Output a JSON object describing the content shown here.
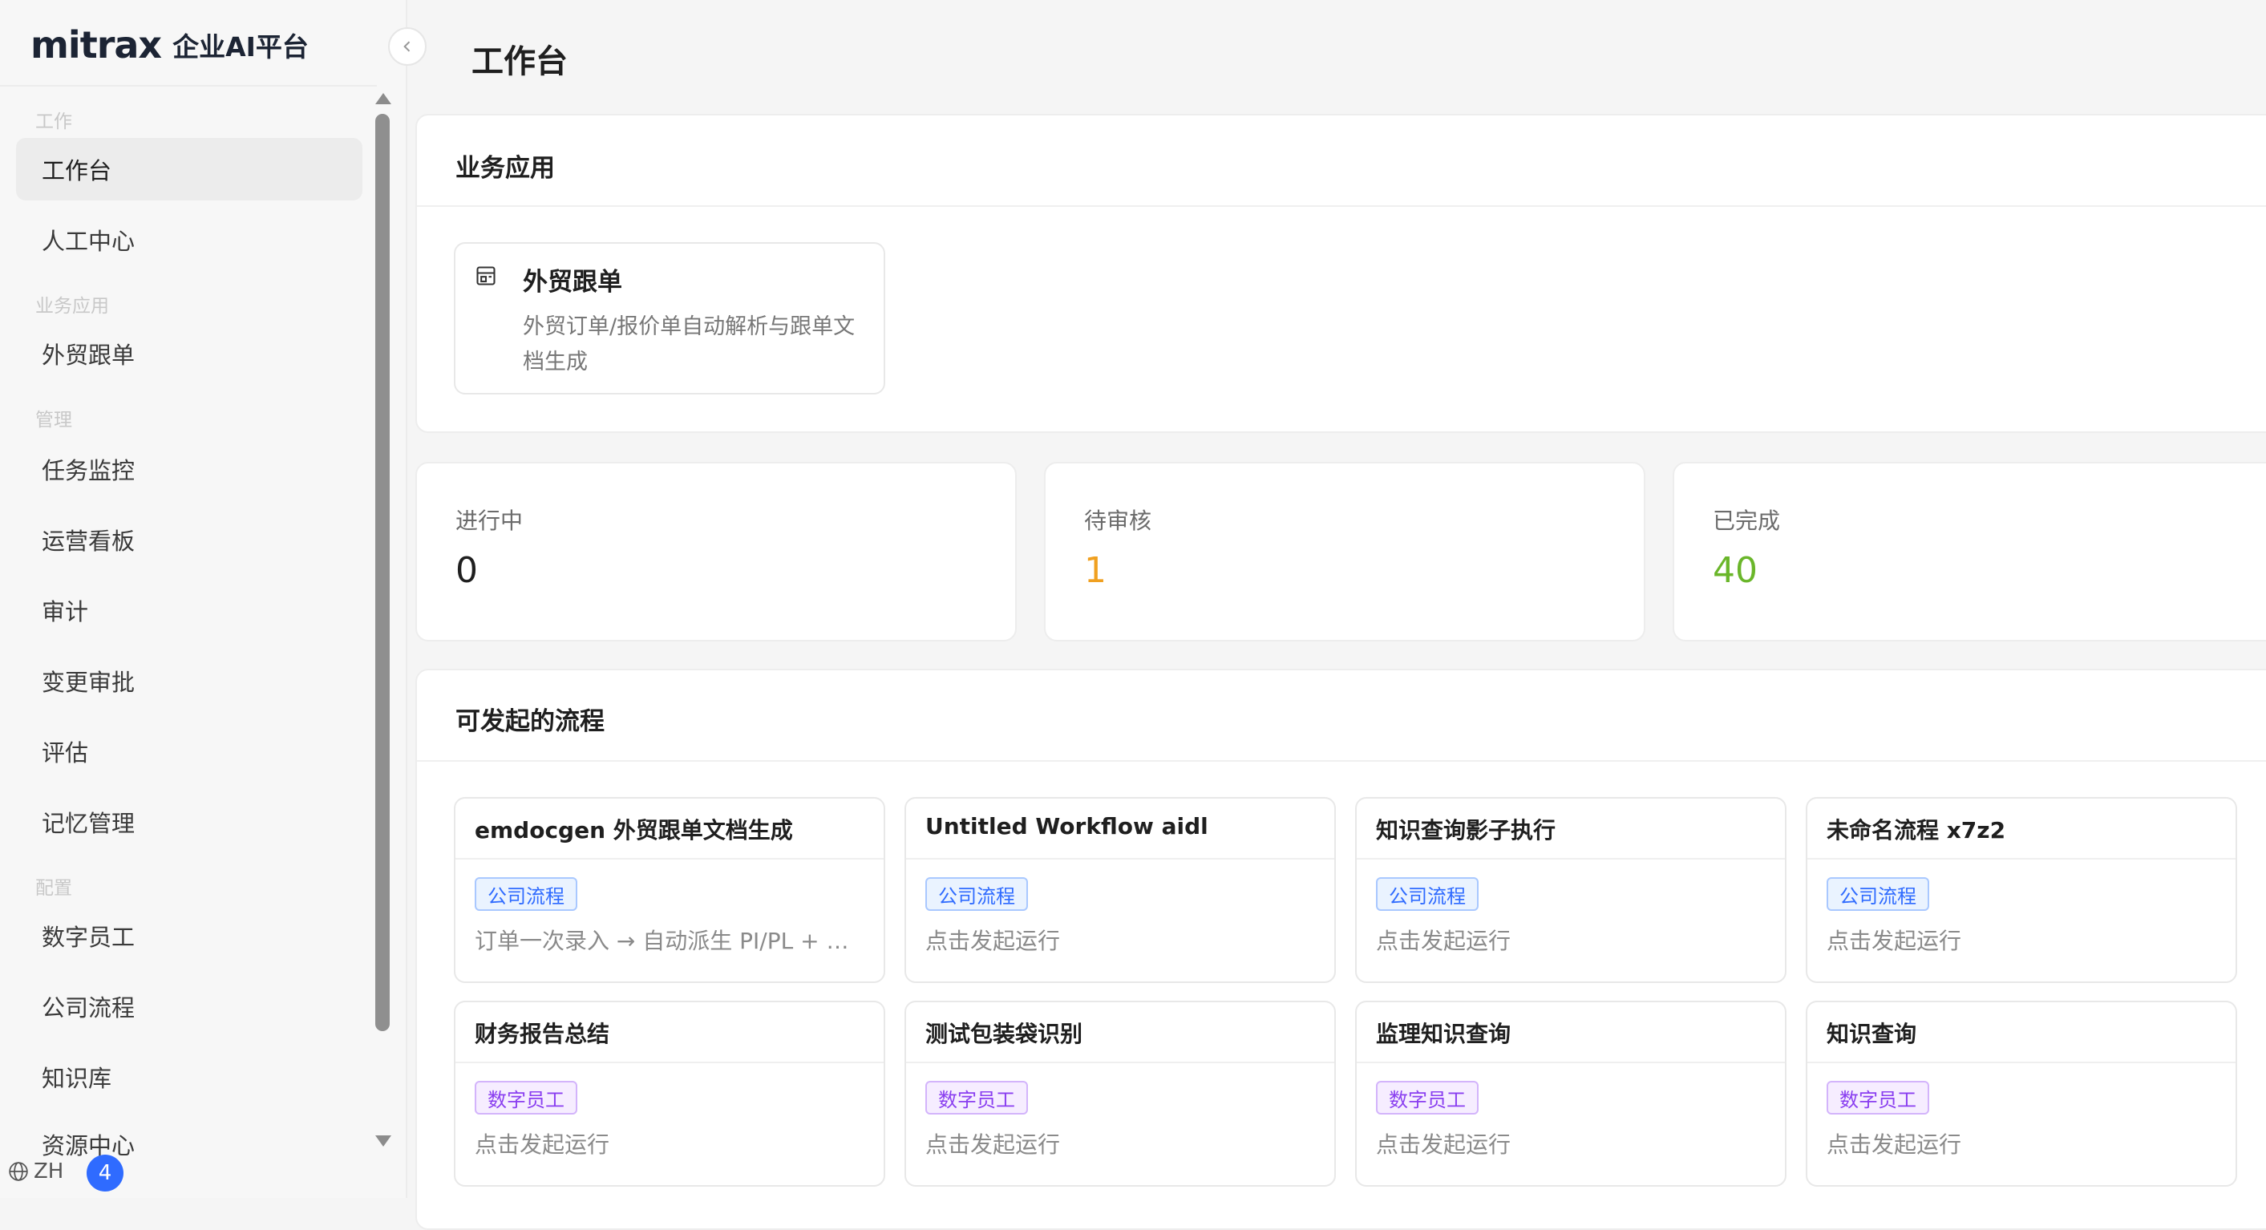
{
  "brand": {
    "logo": "mitrax",
    "name": "企业AI平台"
  },
  "sidebar": {
    "groups": [
      {
        "label": "工作"
      },
      {
        "label": "业务应用"
      },
      {
        "label": "管理"
      },
      {
        "label": "配置"
      }
    ],
    "items": [
      {
        "label": "工作台",
        "active": true
      },
      {
        "label": "人工中心"
      },
      {
        "label": "外贸跟单"
      },
      {
        "label": "任务监控"
      },
      {
        "label": "运营看板"
      },
      {
        "label": "审计"
      },
      {
        "label": "变更审批"
      },
      {
        "label": "评估"
      },
      {
        "label": "记忆管理"
      },
      {
        "label": "数字员工"
      },
      {
        "label": "公司流程"
      },
      {
        "label": "知识库"
      },
      {
        "label": "资源中心"
      }
    ],
    "lang": "ZH",
    "notification_count": "4"
  },
  "main": {
    "title": "工作台",
    "apps": {
      "title": "业务应用",
      "items": [
        {
          "name": "外贸跟单",
          "desc": "外贸订单/报价单自动解析与跟单文档生成",
          "icon": "store-icon"
        }
      ]
    },
    "stats": [
      {
        "label": "进行中",
        "value": "0",
        "color": "#1f1f1f"
      },
      {
        "label": "待审核",
        "value": "1",
        "color": "#f0a020"
      },
      {
        "label": "已完成",
        "value": "40",
        "color": "#6ab62a"
      }
    ],
    "flows": {
      "title": "可发起的流程",
      "items": [
        {
          "name": "emdocgen 外贸跟单文档生成",
          "tag": "公司流程",
          "desc": "订单一次录入 → 自动派生 PI/PL + 跨..."
        },
        {
          "name": "Untitled Workflow aidl",
          "tag": "公司流程",
          "desc": "点击发起运行"
        },
        {
          "name": "知识查询影子执行",
          "tag": "公司流程",
          "desc": "点击发起运行"
        },
        {
          "name": "未命名流程 x7z2",
          "tag": "公司流程",
          "desc": "点击发起运行"
        },
        {
          "name": "财务报告总结",
          "tag": "数字员工",
          "desc": "点击发起运行"
        },
        {
          "name": "测试包装袋识别",
          "tag": "数字员工",
          "desc": "点击发起运行"
        },
        {
          "name": "监理知识查询",
          "tag": "数字员工",
          "desc": "点击发起运行"
        },
        {
          "name": "知识查询",
          "tag": "数字员工",
          "desc": "点击发起运行"
        }
      ]
    }
  }
}
